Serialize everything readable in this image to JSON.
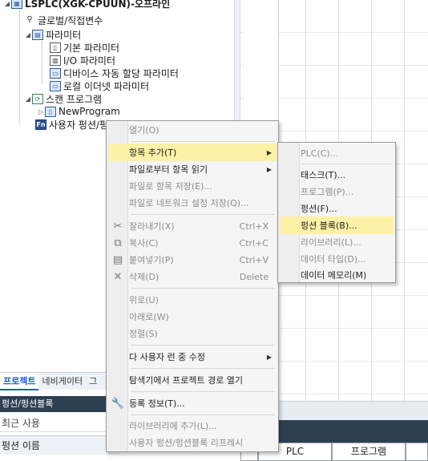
{
  "tree": {
    "root": "LSPLC(XGK-CPUUN)-오프라인",
    "items": [
      "글로벌/직접변수",
      "파라미터",
      "기본 파라미터",
      "I/O 파라미터",
      "디바이스 자동 할당 파라미터",
      "로컬 이더넷 파라미터",
      "스캔 프로그램",
      "NewProgram",
      "사용자 펑션/펑션블록"
    ]
  },
  "bottom_left": {
    "tabs": [
      "프로젝트",
      "네비게이터",
      "그"
    ],
    "panel_header": "펑션/펑션블록",
    "recent": "최근 사용",
    "column": "펑션 이름"
  },
  "bottom_right": {
    "columns": [
      "PLC",
      "프로그램"
    ]
  },
  "context_menu": {
    "items": [
      {
        "label": "열기(O)",
        "enabled": false
      },
      {
        "label": "항목 추가(T)",
        "enabled": true,
        "submenu": true,
        "highlighted": true
      },
      {
        "label": "파일로부터 항목 읽기",
        "enabled": true,
        "submenu": true
      },
      {
        "label": "파일로 항목 저장(E)...",
        "enabled": false
      },
      {
        "label": "파일로 네트워크 설정 저장(Q)...",
        "enabled": false
      },
      {
        "label": "잘라내기(X)",
        "shortcut": "Ctrl+X",
        "enabled": false,
        "icon": "scissors-icon"
      },
      {
        "label": "복사(C)",
        "shortcut": "Ctrl+C",
        "enabled": false,
        "icon": "copy-icon"
      },
      {
        "label": "붙여넣기(P)",
        "shortcut": "Ctrl+V",
        "enabled": false,
        "icon": "paste-icon"
      },
      {
        "label": "삭제(D)",
        "shortcut": "Delete",
        "enabled": false,
        "icon": "delete-x-icon"
      },
      {
        "label": "위로(U)",
        "enabled": false
      },
      {
        "label": "아래로(W)",
        "enabled": false
      },
      {
        "label": "정렬(S)",
        "enabled": false
      },
      {
        "label": "다 사용자 런 중 수정",
        "enabled": true,
        "submenu": true
      },
      {
        "label": "탐색기에서 프로젝트 경로 열기",
        "enabled": true
      },
      {
        "label": "등록 정보(T)...",
        "enabled": true,
        "icon": "wrench-icon"
      },
      {
        "label": "라이브러리에 추가(L)...",
        "enabled": false
      },
      {
        "label": "사용자 펑션/펑션블록 리프레시",
        "enabled": false
      }
    ]
  },
  "submenu": {
    "items": [
      {
        "label": "PLC(C)...",
        "enabled": false
      },
      {
        "label": "태스크(T)...",
        "enabled": true
      },
      {
        "label": "프로그램(P)...",
        "enabled": false
      },
      {
        "label": "펑션(F)...",
        "enabled": true
      },
      {
        "label": "펑션 블록(B)...",
        "enabled": true,
        "highlighted": true
      },
      {
        "label": "라이브러리(L)...",
        "enabled": false
      },
      {
        "label": "데이터 타입(D)...",
        "enabled": false
      },
      {
        "label": "데이터 메모리(M)",
        "enabled": true
      }
    ]
  },
  "colors": {
    "highlight": "#fdf1a8",
    "menu_bg": "#f5f5f5",
    "disabled_text": "#8c8c8c",
    "panel_dark": "#2f3f52",
    "tab_active": "#1f5fbf"
  }
}
